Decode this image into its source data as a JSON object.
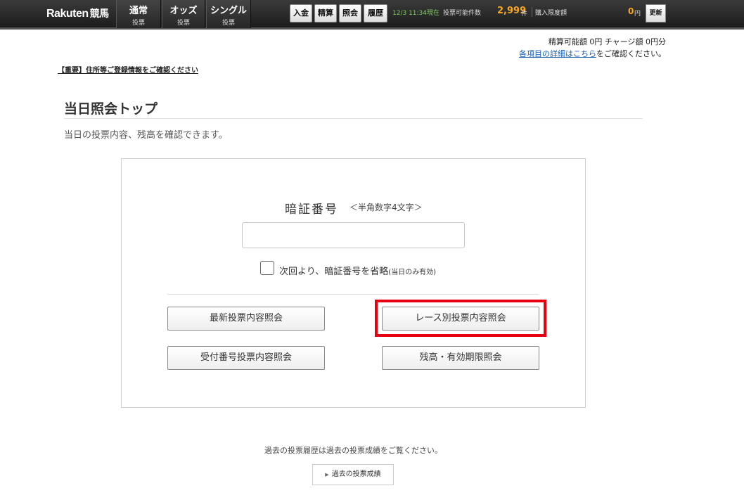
{
  "topbar": {
    "logo_text": "Rakuten",
    "logo_kanji": "競馬",
    "tabs": [
      {
        "title": "通常",
        "sub": "投票"
      },
      {
        "title": "オッズ",
        "sub": "投票"
      },
      {
        "title": "シングル",
        "sub": "投票"
      }
    ],
    "buttons": [
      "入金",
      "精算",
      "照会",
      "履歴"
    ],
    "datetime": "12/3 11:34現在",
    "vote_count_label": "投票可能件数",
    "vote_count": "2,999",
    "vote_count_unit": "件",
    "limit_label": "購入限度額",
    "limit_value": "0",
    "limit_unit": "円",
    "refresh_label": "更新"
  },
  "account": {
    "settle_text": "精算可能額 0円 チャージ額 0円分",
    "detail_link": "各項目の詳細はこちら",
    "detail_suffix": "をご確認ください。"
  },
  "notice": "【重要】住所等ご登録情報をご確認ください",
  "page": {
    "title": "当日照会トップ",
    "description": "当日の投票内容、残高を確認できます。"
  },
  "pin": {
    "label": "暗証番号",
    "hint": "＜半角数字4文字＞",
    "value": "",
    "remember_label": "次回より、暗証番号を省略",
    "remember_note": "(当日のみ有効)"
  },
  "actions": {
    "latest": "最新投票内容照会",
    "by_race": "レース別投票内容照会",
    "by_receipt": "受付番号投票内容照会",
    "balance": "残高・有効期限照会"
  },
  "past": {
    "text": "過去の投票履歴は過去の投票成績をご覧ください。",
    "button": "過去の投票成績"
  },
  "colors": {
    "highlight": "#e60012",
    "accent": "#f5a623",
    "link": "#1a5fb4"
  }
}
